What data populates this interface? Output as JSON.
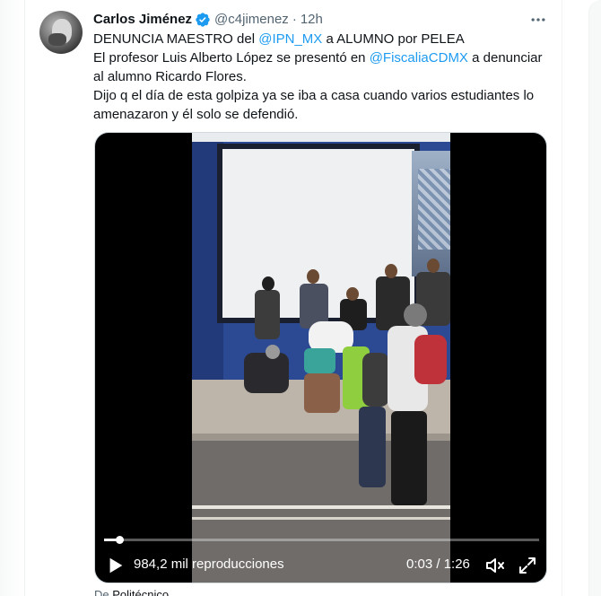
{
  "tweet": {
    "author_name": "Carlos Jiménez",
    "handle": "@c4jimenez",
    "separator": "·",
    "time": "12h",
    "lines": [
      {
        "pre": "DENUNCIA MAESTRO del ",
        "mention": "@IPN_MX",
        "post": " a ALUMNO por PELEA"
      },
      {
        "pre": "El profesor Luis Alberto López se presentó en ",
        "mention": "@FiscaliaCDMX",
        "post": " a denunciar"
      },
      {
        "pre": "al alumno Ricardo Flores.",
        "mention": "",
        "post": ""
      },
      {
        "pre": "Dijo q el día de esta golpiza ya se iba a casa cuando varios estudiantes lo",
        "mention": "",
        "post": ""
      },
      {
        "pre": "amenazaron y él solo se defendió.",
        "mention": "",
        "post": ""
      }
    ]
  },
  "video": {
    "views": "984,2 mil reproducciones",
    "time_readout": "0:03 / 1:26",
    "progress": 0.035
  },
  "caption": {
    "prefix": "De",
    "source": "Politécnico"
  },
  "colors": {
    "accent": "#1d9bf0",
    "text": "#0f1419",
    "muted": "#536471"
  },
  "icons": {
    "verified": "verified-badge-icon",
    "more": "more-options-icon",
    "play": "play-icon",
    "volume": "volume-icon",
    "fullscreen": "fullscreen-icon"
  }
}
